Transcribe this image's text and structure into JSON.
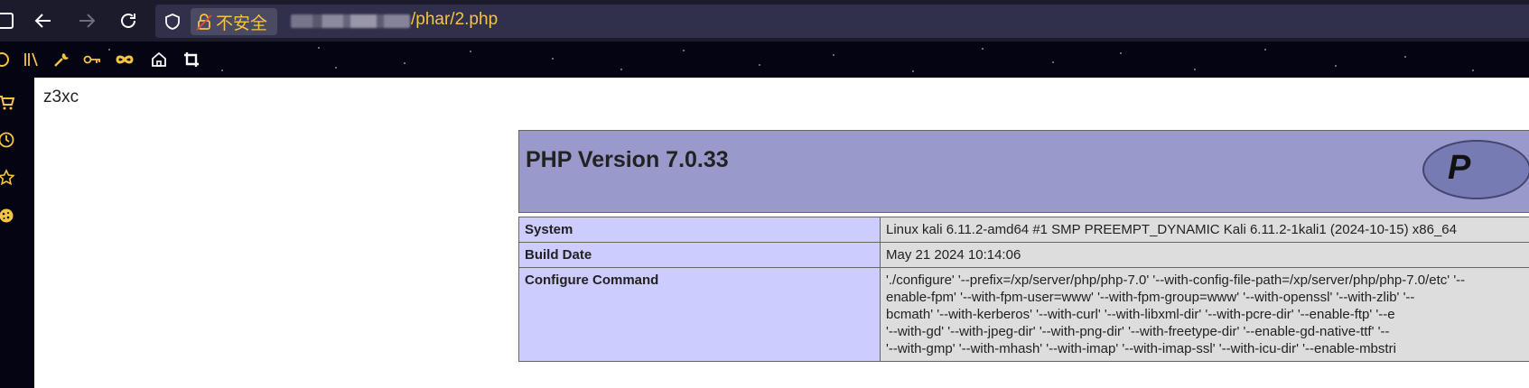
{
  "browser": {
    "security_label": "不安全",
    "url_path": "/phar/2.php",
    "colors": {
      "toolbar": "#1c1b2b",
      "urlbar": "#31304b",
      "accent": "#f6c343",
      "bookmarks_bar": "#050412"
    },
    "nav_icons": [
      "sidebar-icon",
      "back-arrow-icon",
      "forward-arrow-icon",
      "reload-icon"
    ],
    "urlbar_icons": [
      "shield-icon",
      "insecure-lock-icon"
    ],
    "bookmark_icons": [
      "power-icon",
      "library-icon",
      "wrench-icon",
      "key-icon",
      "infinity-icon",
      "home-icon",
      "crop-icon"
    ],
    "sidebar_icons": [
      "cart-icon",
      "clock-icon",
      "star-icon",
      "cookie-icon"
    ]
  },
  "page": {
    "echo_text": "z3xc",
    "php": {
      "version_title": "PHP Version 7.0.33",
      "colors": {
        "header": "#9999cc",
        "key_cell": "#ccccff",
        "value_cell": "#dddddd"
      },
      "rows": [
        {
          "key": "System",
          "value": "Linux kali 6.11.2-amd64 #1 SMP PREEMPT_DYNAMIC Kali 6.11.2-1kali1 (2024-10-15) x86_64"
        },
        {
          "key": "Build Date",
          "value": "May 21 2024 10:14:06"
        }
      ],
      "configure": {
        "key": "Configure Command",
        "lines": [
          "'./configure' '--prefix=/xp/server/php/php-7.0' '--with-config-file-path=/xp/server/php/php-7.0/etc' '--",
          "enable-fpm' '--with-fpm-user=www' '--with-fpm-group=www' '--with-openssl' '--with-zlib' '--",
          "bcmath' '--with-kerberos' '--with-curl' '--with-libxml-dir' '--with-pcre-dir' '--enable-ftp' '--e",
          "'--with-gd' '--with-jpeg-dir' '--with-png-dir' '--with-freetype-dir' '--enable-gd-native-ttf' '--",
          "'--with-gmp' '--with-mhash' '--with-imap' '--with-imap-ssl' '--with-icu-dir' '--enable-mbstri"
        ]
      }
    }
  }
}
